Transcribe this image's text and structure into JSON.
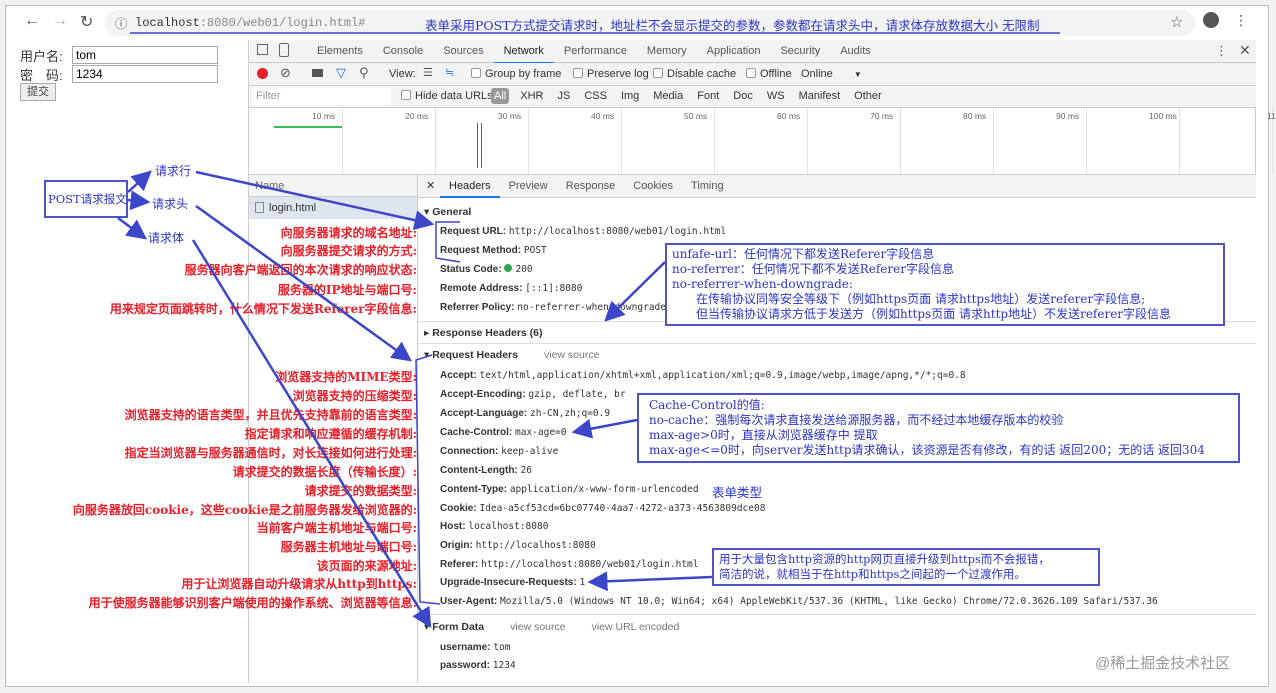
{
  "browser": {
    "url_host": "localhost",
    "url_rest": ":8080/web01/login.html#",
    "url_note": "表单采用POST方式提交请求时，地址栏不会显示提交的参数，参数都在请求头中，请求体存放数据大小 无限制"
  },
  "page": {
    "username_label": "用户名:",
    "username_value": "tom",
    "password_label": "密　码:",
    "password_value": "1234",
    "submit_label": "提交"
  },
  "devtools": {
    "tabs": [
      "Elements",
      "Console",
      "Sources",
      "Network",
      "Performance",
      "Memory",
      "Application",
      "Security",
      "Audits"
    ],
    "active_tab": "Network",
    "toolbar": {
      "view": "View:",
      "group_by_frame": "Group by frame",
      "preserve_log": "Preserve log",
      "disable_cache": "Disable cache",
      "offline": "Offline",
      "online": "Online"
    },
    "filter": {
      "placeholder": "Filter",
      "hide_data_urls": "Hide data URLs",
      "types": [
        "All",
        "XHR",
        "JS",
        "CSS",
        "Img",
        "Media",
        "Font",
        "Doc",
        "WS",
        "Manifest",
        "Other"
      ]
    },
    "timeline_ticks": [
      "10 ms",
      "20 ms",
      "30 ms",
      "40 ms",
      "50 ms",
      "60 ms",
      "70 ms",
      "80 ms",
      "90 ms",
      "100 ms",
      "110"
    ],
    "name_header": "Name",
    "file": "login.html",
    "detail_tabs": [
      "Headers",
      "Preview",
      "Response",
      "Cookies",
      "Timing"
    ],
    "general": {
      "title": "General",
      "rows": [
        {
          "k": "Request URL:",
          "v": "http://localhost:8080/web01/login.html"
        },
        {
          "k": "Request Method:",
          "v": "POST"
        },
        {
          "k": "Status Code:",
          "v": "200"
        },
        {
          "k": "Remote Address:",
          "v": "[::1]:8080"
        },
        {
          "k": "Referrer Policy:",
          "v": "no-referrer-when-downgrade"
        }
      ]
    },
    "response_headers": "Response Headers (6)",
    "request_headers": {
      "title": "Request Headers",
      "view_source": "view source",
      "rows": [
        {
          "k": "Accept:",
          "v": "text/html,application/xhtml+xml,application/xml;q=0.9,image/webp,image/apng,*/*;q=0.8"
        },
        {
          "k": "Accept-Encoding:",
          "v": "gzip, deflate, br"
        },
        {
          "k": "Accept-Language:",
          "v": "zh-CN,zh;q=0.9"
        },
        {
          "k": "Cache-Control:",
          "v": "max-age=0"
        },
        {
          "k": "Connection:",
          "v": "keep-alive"
        },
        {
          "k": "Content-Length:",
          "v": "26"
        },
        {
          "k": "Content-Type:",
          "v": "application/x-www-form-urlencoded"
        },
        {
          "k": "Cookie:",
          "v": "Idea-a5cf53cd=6bc07740-4aa7-4272-a373-4563809dce08"
        },
        {
          "k": "Host:",
          "v": "localhost:8080"
        },
        {
          "k": "Origin:",
          "v": "http://localhost:8080"
        },
        {
          "k": "Referer:",
          "v": "http://localhost:8080/web01/login.html"
        },
        {
          "k": "Upgrade-Insecure-Requests:",
          "v": "1"
        },
        {
          "k": "User-Agent:",
          "v": "Mozilla/5.0 (Windows NT 10.0; Win64; x64) AppleWebKit/537.36 (KHTML, like Gecko) Chrome/72.0.3626.109 Safari/537.36"
        }
      ]
    },
    "form_data": {
      "title": "Form Data",
      "view_source": "view source",
      "view_url_encoded": "view URL encoded",
      "rows": [
        {
          "k": "username:",
          "v": "tom"
        },
        {
          "k": "password:",
          "v": "1234"
        }
      ]
    }
  },
  "annotations": {
    "post_box": "POST请求报文",
    "line": "请求行",
    "header": "请求头",
    "body": "请求体",
    "general_labels": [
      "向服务器请求的域名地址:",
      "向服务器提交请求的方式:",
      "服务器向客户端返回的本次请求的响应状态:",
      "服务器的IP地址与端口号:",
      "用来规定页面跳转时，什么情况下发送Referer字段信息:"
    ],
    "header_labels": [
      "浏览器支持的MIME类型:",
      "浏览器支持的压缩类型:",
      "浏览器支持的语言类型，并且优先支持靠前的语言类型:",
      "指定请求和响应遵循的缓存机制:",
      "指定当浏览器与服务器通信时，对长连接如何进行处理:",
      "请求提交的数据长度（传输长度）:",
      "请求提交的数据类型:",
      "向服务器放回cookie，这些cookie是之前服务器发给浏览器的:",
      "当前客户端主机地址与端口号:",
      "服务器主机地址与端口号:",
      "该页面的来源地址:",
      "用于让浏览器自动升级请求从http到https:",
      "用于使服务器能够识别客户端使用的操作系统、浏览器等信息:"
    ],
    "referrer_box": [
      "unfafe-url：任何情况下都发送Referer字段信息",
      "no-referrer：任何情况下都不发送Referer字段信息",
      "no-referrer-when-downgrade:",
      "　　在传输协议同等安全等级下（例如https页面 请求https地址）发送referer字段信息;",
      "　　但当传输协议请求方低于发送方（例如https页面 请求http地址）不发送referer字段信息"
    ],
    "cache_box": [
      "Cache-Control的值:",
      "no-cache：强制每次请求直接发送给源服务器，而不经过本地缓存版本的校验",
      "max-age>0时，直接从浏览器缓存中 提取",
      "max-age<=0时，向server发送http请求确认，该资源是否有修改，有的话 返回200；无的话 返回304"
    ],
    "form_type": "表单类型",
    "upgrade_box": [
      "用于大量包含http资源的http网页直接升级到https而不会报错，",
      "简洁的说，就相当于在http和https之间起的一个过渡作用。"
    ]
  },
  "watermark": "@稀土掘金技术社区",
  "colors": {
    "annotation_blue": "#2c35c8",
    "annotation_red": "#e8202a",
    "active_tab": "#1a73e8",
    "record": "#e8202a",
    "status_ok": "#2ea44f"
  }
}
